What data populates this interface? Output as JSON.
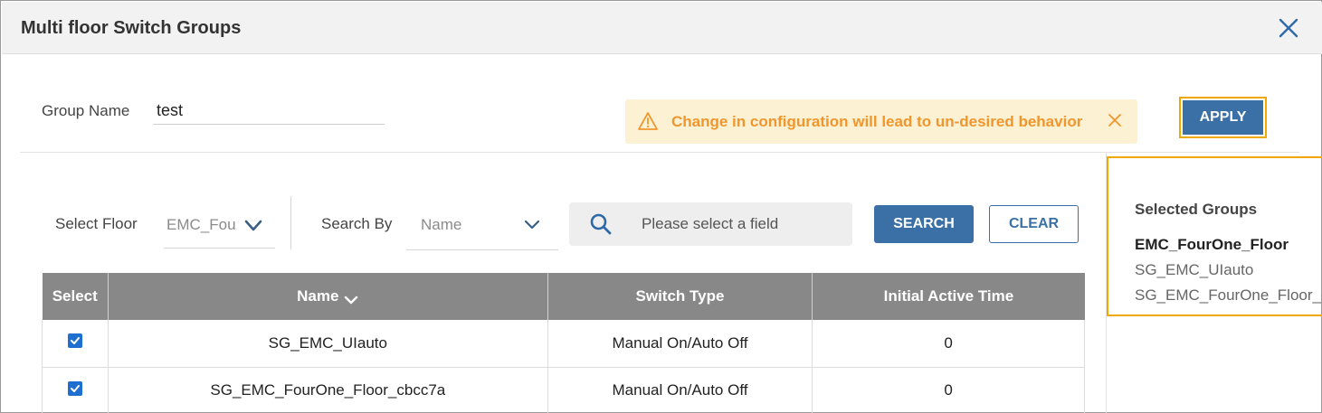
{
  "dialog": {
    "title": "Multi floor Switch Groups"
  },
  "form": {
    "group_name_label": "Group Name",
    "group_name_value": "test"
  },
  "warning": {
    "text": "Change in configuration will lead to un-desired behavior"
  },
  "actions": {
    "apply_label": "APPLY",
    "search_label": "SEARCH",
    "clear_label": "CLEAR"
  },
  "filters": {
    "floor_label": "Select Floor",
    "floor_value": "EMC_Fou",
    "search_by_label": "Search By",
    "search_by_value": "Name",
    "search_placeholder": "Please select a field"
  },
  "table": {
    "columns": [
      "Select",
      "Name",
      "Switch Type",
      "Initial Active Time"
    ],
    "rows": [
      {
        "checked": true,
        "name": "SG_EMC_UIauto",
        "switch_type": "Manual On/Auto Off",
        "initial_active_time": "0"
      },
      {
        "checked": true,
        "name": "SG_EMC_FourOne_Floor_cbcc7a",
        "switch_type": "Manual On/Auto Off",
        "initial_active_time": "0"
      }
    ]
  },
  "selected_groups": {
    "title": "Selected Groups",
    "floor": "EMC_FourOne_Floor",
    "items": [
      "SG_EMC_UIauto",
      "SG_EMC_FourOne_Floor_c"
    ]
  },
  "colors": {
    "primary": "#3a70a5",
    "warning_text": "#f0962c",
    "warning_bg": "#fcf1d3",
    "highlight": "#f0a800",
    "table_header": "#888888",
    "checkbox": "#1f6fd1"
  }
}
